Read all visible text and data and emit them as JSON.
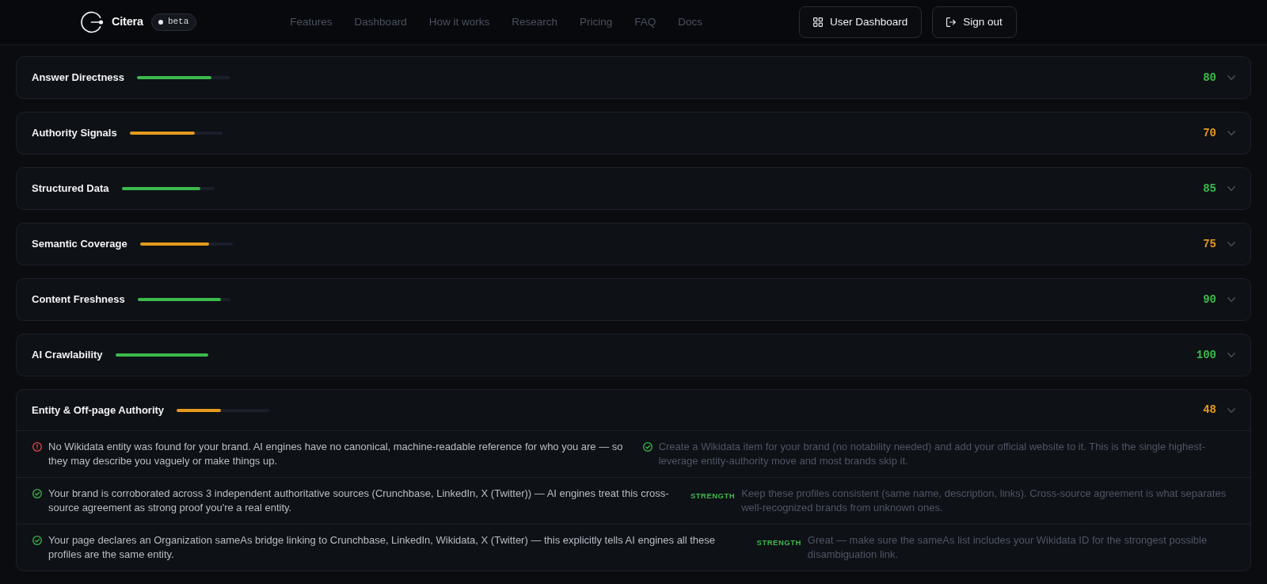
{
  "header": {
    "brand": "Citera",
    "version": "beta",
    "nav": [
      "Features",
      "Dashboard",
      "How it works",
      "Research",
      "Pricing",
      "FAQ",
      "Docs"
    ],
    "dashboard_button": {
      "label": "User Dashboard"
    },
    "sign_out_button": {
      "label": "Sign out"
    }
  },
  "categories": [
    {
      "name": "Answer Directness",
      "level": 0.8,
      "score": "80",
      "color": "#3cba4c"
    },
    {
      "name": "Authority Signals",
      "level": 0.7,
      "score": "70",
      "color": "#e39a1e"
    },
    {
      "name": "Structured Data",
      "level": 0.85,
      "score": "85",
      "color": "#3cba4c"
    },
    {
      "name": "Semantic Coverage",
      "level": 0.75,
      "score": "75",
      "color": "#e39a1e"
    },
    {
      "name": "Content Freshness",
      "level": 0.9,
      "score": "90",
      "color": "#3cba4c"
    },
    {
      "name": "AI Crawlability",
      "level": 1,
      "score": "100",
      "color": "#3cba4c"
    },
    {
      "name": "Entity & Off-page Authority",
      "level": 0.48,
      "score": "48",
      "color": "#e39a1e",
      "findings": [
        {
          "kind": "issue",
          "text": "No Wikidata entity was found for your brand. AI engines have no canonical, machine-readable reference for who you are — so they may describe you vaguely or make things up.",
          "fix": {
            "kind": "tip",
            "text": "Create a Wikidata item for your brand (no notability needed) and add your official website to it. This is the single highest-leverage entity-authority move and most brands skip it."
          }
        },
        {
          "kind": "pass",
          "text": "Your brand is corroborated across 3 independent authoritative sources (Crunchbase, LinkedIn, X (Twitter)) — AI engines treat this cross-source agreement as strong proof you're a real entity.",
          "fix": {
            "kind": "strength",
            "label": "STRENGTH",
            "text": "Keep these profiles consistent (same name, description, links). Cross-source agreement is what separates well-recognized brands from unknown ones."
          }
        },
        {
          "kind": "pass",
          "text": "Your page declares an Organization sameAs bridge linking to Crunchbase, LinkedIn, Wikidata, X (Twitter) — this explicitly tells AI engines all these profiles are the same entity.",
          "fix": {
            "kind": "strength",
            "label": "STRENGTH",
            "text": "Great — make sure the sameAs list includes your Wikidata ID for the strongest possible disambiguation link."
          }
        }
      ]
    }
  ]
}
